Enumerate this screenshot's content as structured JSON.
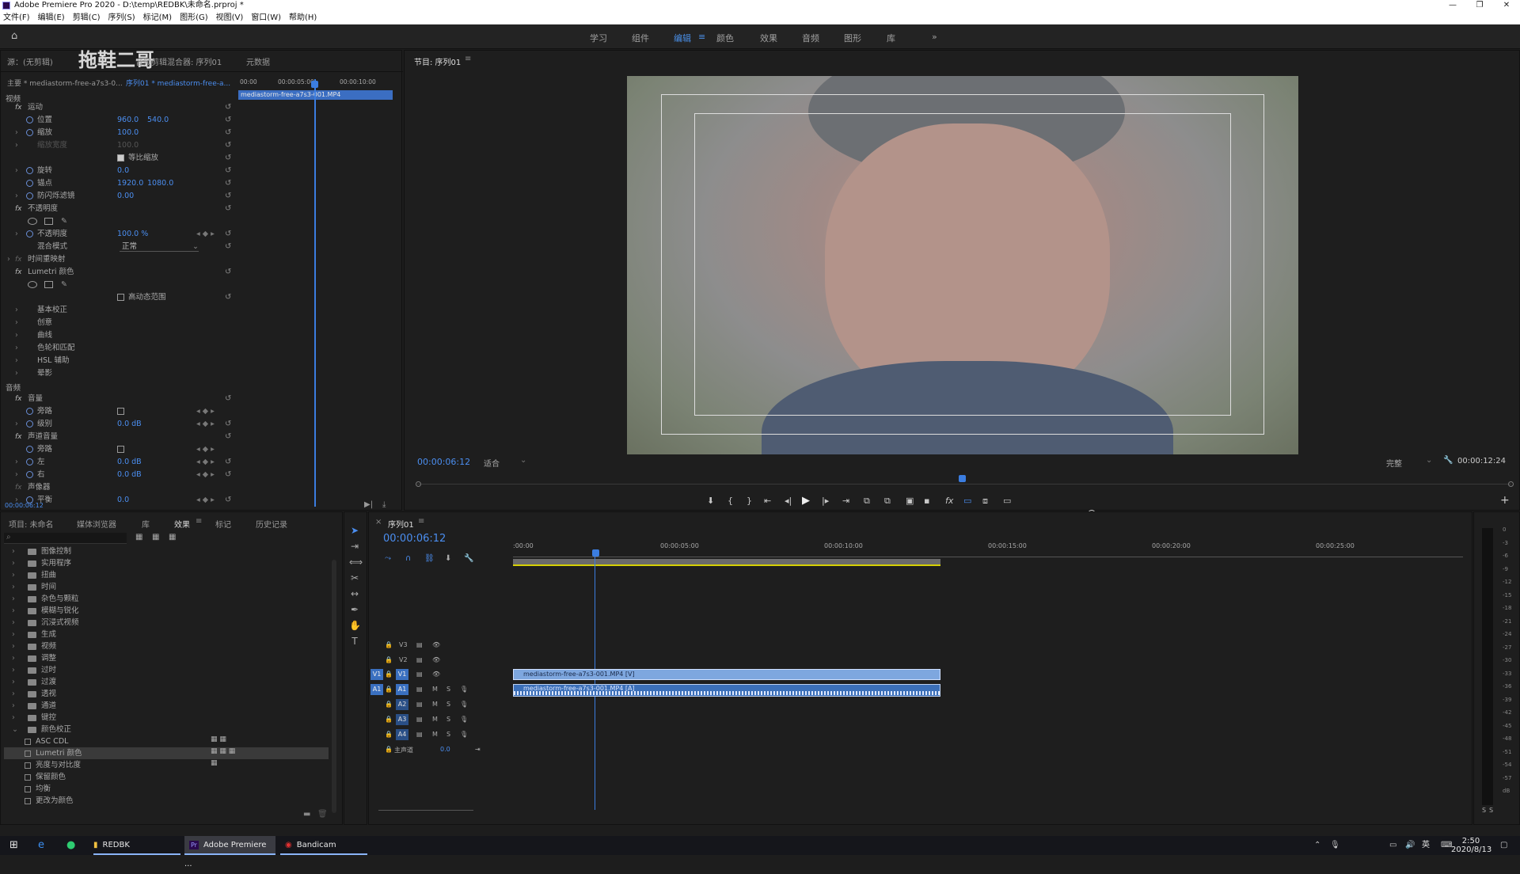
{
  "window": {
    "title": "Adobe Premiere Pro 2020 - D:\\temp\\REDBK\\未命名.prproj *"
  },
  "menu": [
    "文件(F)",
    "编辑(E)",
    "剪辑(C)",
    "序列(S)",
    "标记(M)",
    "图形(G)",
    "视图(V)",
    "窗口(W)",
    "帮助(H)"
  ],
  "workspaces": {
    "items": [
      "学习",
      "组件",
      "编辑",
      "颜色",
      "效果",
      "音频",
      "图形",
      "库"
    ],
    "active": "编辑",
    "more": "»"
  },
  "watermark": "拖鞋二哥",
  "effect_controls": {
    "tabs": [
      "源：(无剪辑)",
      "音频剪辑混合器: 序列01",
      "元数据"
    ],
    "master_label": "主要 * mediastorm-free-a7s3-0...",
    "seq_label": "序列01 * mediastorm-free-a...",
    "ruler": [
      "00:00",
      "00:00:05:00",
      "00:00:10:00"
    ],
    "clip_name": "mediastorm-free-a7s3-001.MP4",
    "video_header": "视频",
    "motion": {
      "label": "运动",
      "position": {
        "label": "位置",
        "x": "960.0",
        "y": "540.0"
      },
      "scale": {
        "label": "缩放",
        "value": "100.0"
      },
      "scale_width": {
        "label": "缩放宽度",
        "value": "100.0"
      },
      "uniform_scale": "等比缩放",
      "rotation": {
        "label": "旋转",
        "value": "0.0"
      },
      "anchor": {
        "label": "锚点",
        "x": "1920.0",
        "y": "1080.0"
      },
      "anti_flicker": {
        "label": "防闪烁滤镜",
        "value": "0.00"
      }
    },
    "opacity": {
      "label": "不透明度",
      "prop": "不透明度",
      "value": "100.0 %",
      "blend_label": "混合模式",
      "blend_value": "正常"
    },
    "time_remap": "时间重映射",
    "lumetri": {
      "label": "Lumetri 颜色",
      "hdr": "高动态范围",
      "sections": [
        "基本校正",
        "创意",
        "曲线",
        "色轮和匹配",
        "HSL 辅助",
        "晕影"
      ]
    },
    "audio_header": "音频",
    "volume": {
      "label": "音量",
      "bypass": "旁路",
      "level": "级别",
      "level_value": "0.0 dB"
    },
    "channel_volume": {
      "label": "声道音量",
      "bypass": "旁路",
      "left": "左",
      "left_value": "0.0 dB",
      "right": "右",
      "right_value": "0.0 dB"
    },
    "panner": {
      "label": "声像器",
      "balance": "平衡",
      "balance_value": "0.0"
    },
    "timecode": "00:00:06:12"
  },
  "program_monitor": {
    "tab": "节目: 序列01",
    "timecode": "00:00:06:12",
    "fit": "适合",
    "quality": "完整",
    "duration": "00:00:12:24"
  },
  "project_panel": {
    "tabs": [
      "项目: 未命名",
      "媒体浏览器",
      "库",
      "效果",
      "标记",
      "历史记录"
    ],
    "active_tab": "效果",
    "tree": [
      "图像控制",
      "实用程序",
      "扭曲",
      "时间",
      "杂色与颗粒",
      "模糊与锐化",
      "沉浸式视频",
      "生成",
      "视频",
      "调整",
      "过时",
      "过渡",
      "透视",
      "通道",
      "键控",
      "颜色校正"
    ],
    "children": [
      "ASC CDL",
      "Lumetri 颜色",
      "亮度与对比度",
      "保留颜色",
      "均衡",
      "更改为颜色"
    ]
  },
  "timeline": {
    "tab": "序列01",
    "timecode": "00:00:06:12",
    "ruler": [
      ":00:00",
      "00:00:05:00",
      "00:00:10:00",
      "00:00:15:00",
      "00:00:20:00",
      "00:00:25:00"
    ],
    "video_tracks": [
      "V3",
      "V2",
      "V1"
    ],
    "audio_tracks": [
      "A1",
      "A2",
      "A3",
      "A4"
    ],
    "source_v": "V1",
    "source_a": "A1",
    "m_label": "M",
    "s_label": "S",
    "master": "主声道",
    "master_value": "0.0",
    "video_clip": "mediastorm-free-a7s3-001.MP4 [V]",
    "audio_clip": "mediastorm-free-a7s3-001.MP4 [A]"
  },
  "meter": {
    "scale": [
      "0",
      "-3",
      "-6",
      "-9",
      "-12",
      "-15",
      "-18",
      "-21",
      "-24",
      "-27",
      "-30",
      "-33",
      "-36",
      "-39",
      "-42",
      "-45",
      "-48",
      "-51",
      "-54",
      "-57",
      "dB"
    ],
    "solo": [
      "S",
      "S"
    ]
  },
  "taskbar": {
    "items": [
      "REDBK",
      "Adobe Premiere ...",
      "Bandicam"
    ],
    "ime": "英",
    "time": "2:50",
    "date": "2020/8/13"
  }
}
